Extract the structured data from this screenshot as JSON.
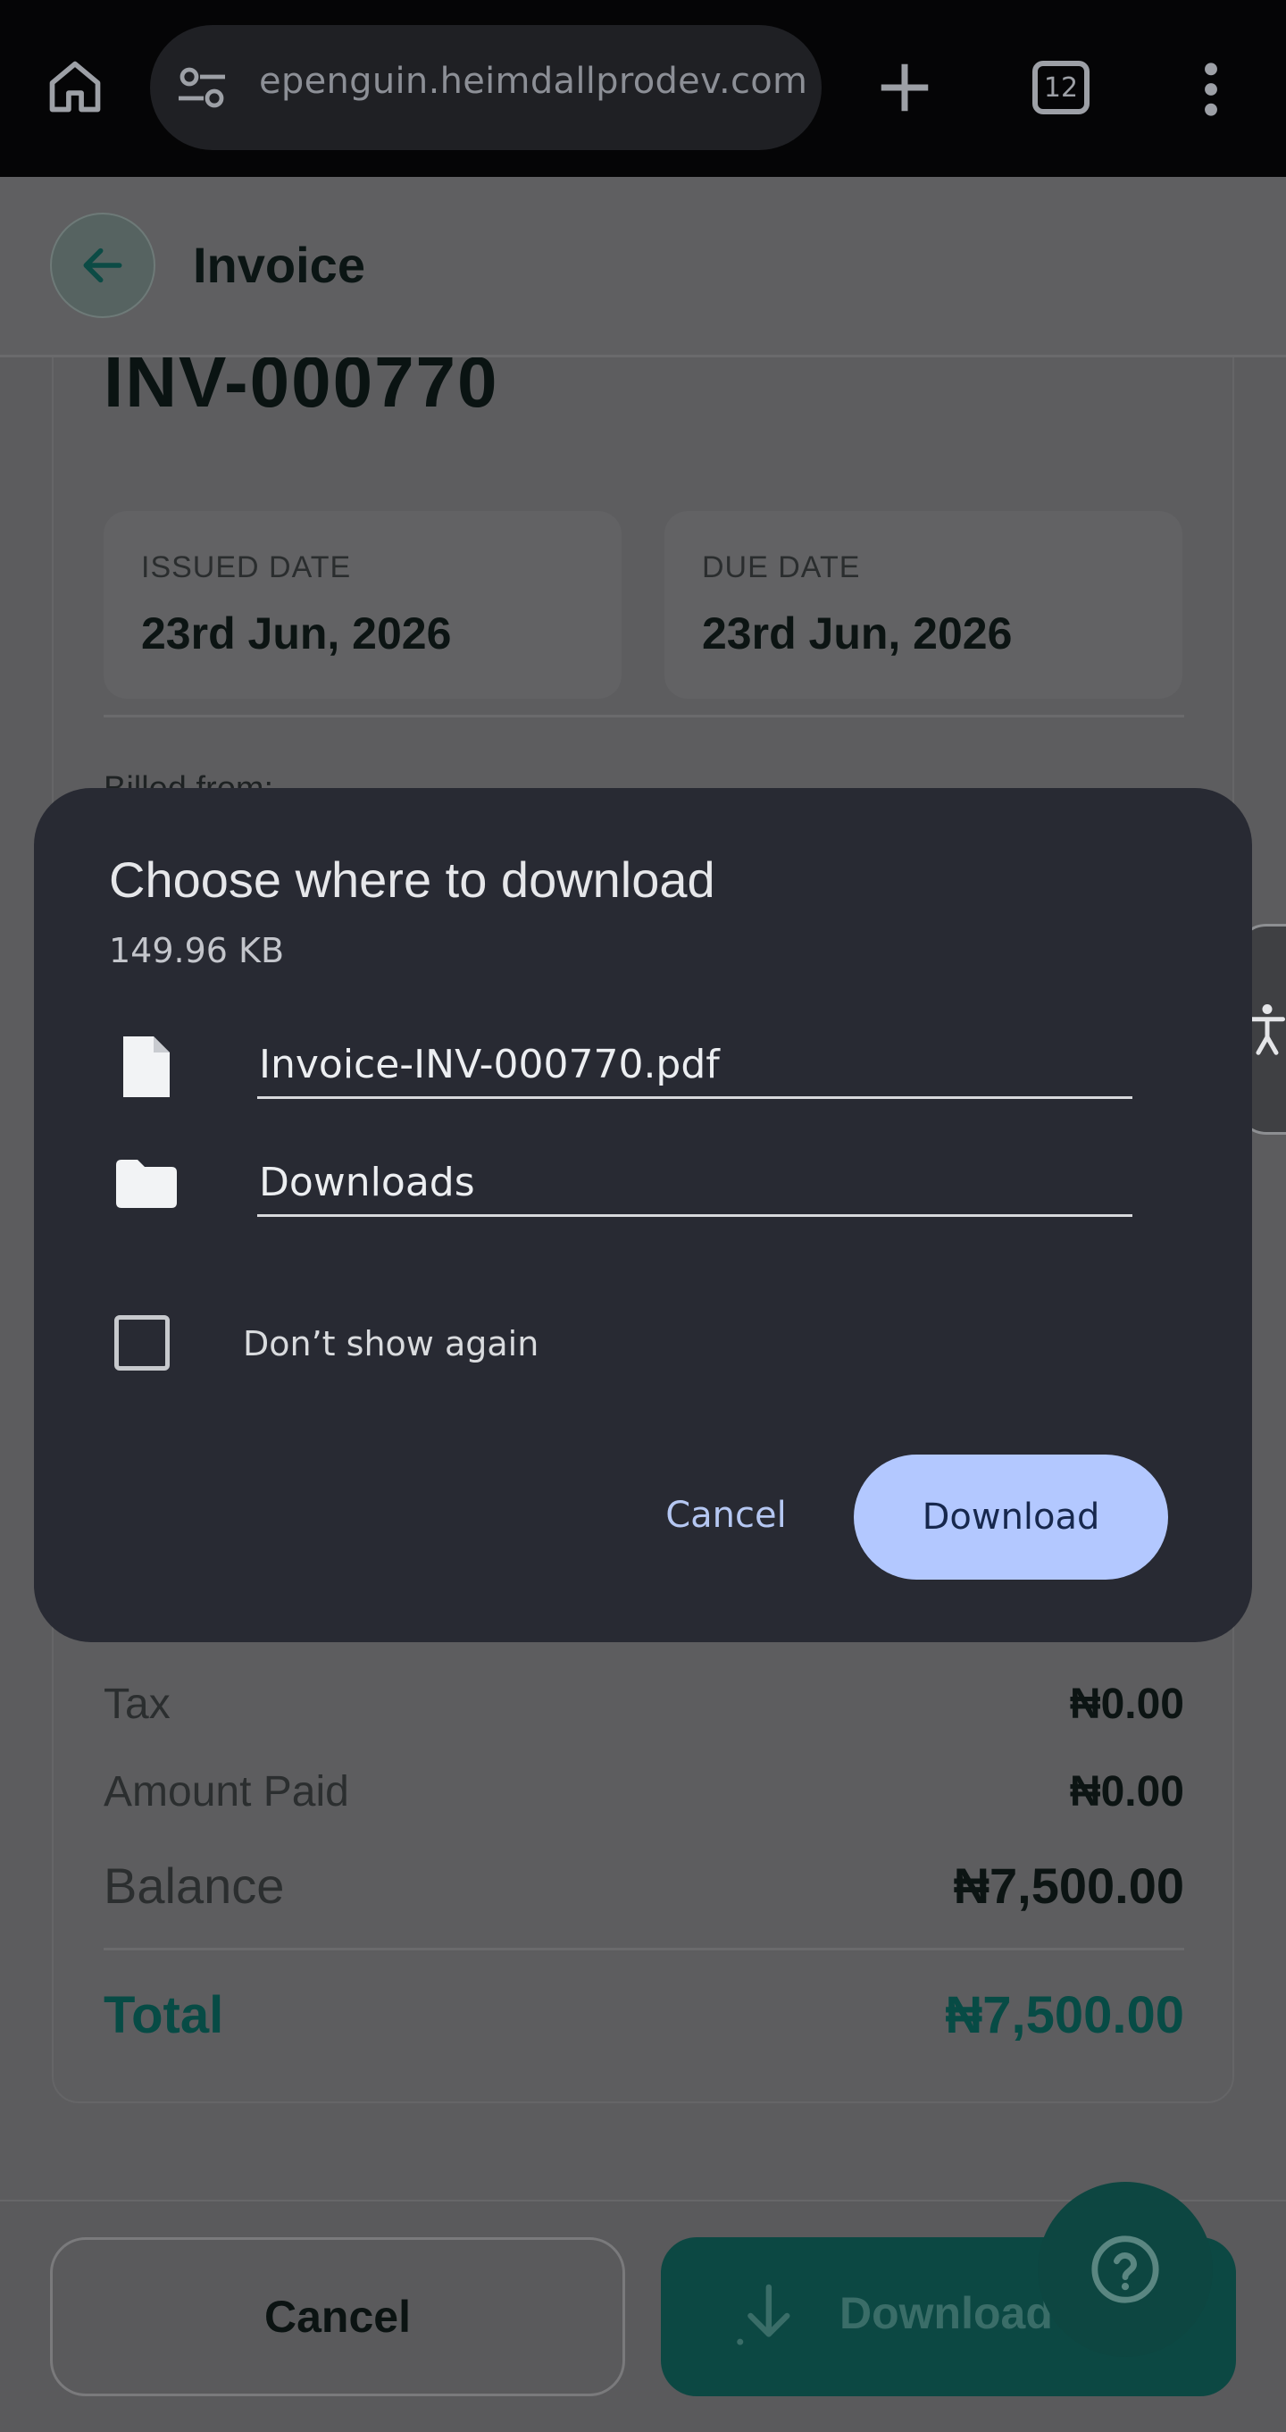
{
  "browser": {
    "url": "epenguin.heimdallprodev.com",
    "tab_count": "12",
    "icons": [
      "home-icon",
      "site-settings-icon",
      "new-tab-icon",
      "tab-switcher-icon",
      "more-menu-icon"
    ]
  },
  "appbar": {
    "title": "Invoice"
  },
  "invoice": {
    "number": "INV-000770",
    "issued_label": "ISSUED DATE",
    "issued_value": "23rd Jun, 2026",
    "due_label": "DUE DATE",
    "due_value": "23rd Jun, 2026",
    "billed_from_label": "Billed from:"
  },
  "summary": {
    "tax_label": "Tax",
    "tax_value": "₦0.00",
    "paid_label": "Amount Paid",
    "paid_value": "₦0.00",
    "balance_label": "Balance",
    "balance_value": "₦7,500.00",
    "total_label": "Total",
    "total_value": "₦7,500.00"
  },
  "footer": {
    "cancel_label": "Cancel",
    "download_label": "Download"
  },
  "dialog": {
    "title": "Choose where to download",
    "size": "149.96 KB",
    "filename": "Invoice-INV-000770.pdf",
    "location": "Downloads",
    "checkbox_label": "Don’t show again",
    "checkbox_checked": false,
    "cancel_label": "Cancel",
    "download_label": "Download"
  },
  "colors": {
    "dialog_bg": "#282a33",
    "primary_button": "#b3c8ff",
    "brand_teal": "#0c4843"
  }
}
